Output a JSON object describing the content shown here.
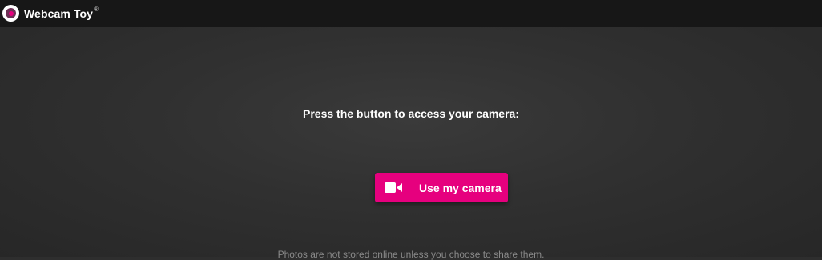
{
  "header": {
    "brand": "Webcam Toy",
    "trademark": "®",
    "logo_icon": "webcam-toy-logo-icon"
  },
  "main": {
    "prompt": "Press the button to access your camera:",
    "camera_button": {
      "label": "Use my camera",
      "icon": "video-camera-icon"
    },
    "note": "Photos are not stored online unless you choose to share them."
  },
  "colors": {
    "accent": "#e6007e",
    "topbar": "#171717",
    "background": "#2e2e2e"
  }
}
